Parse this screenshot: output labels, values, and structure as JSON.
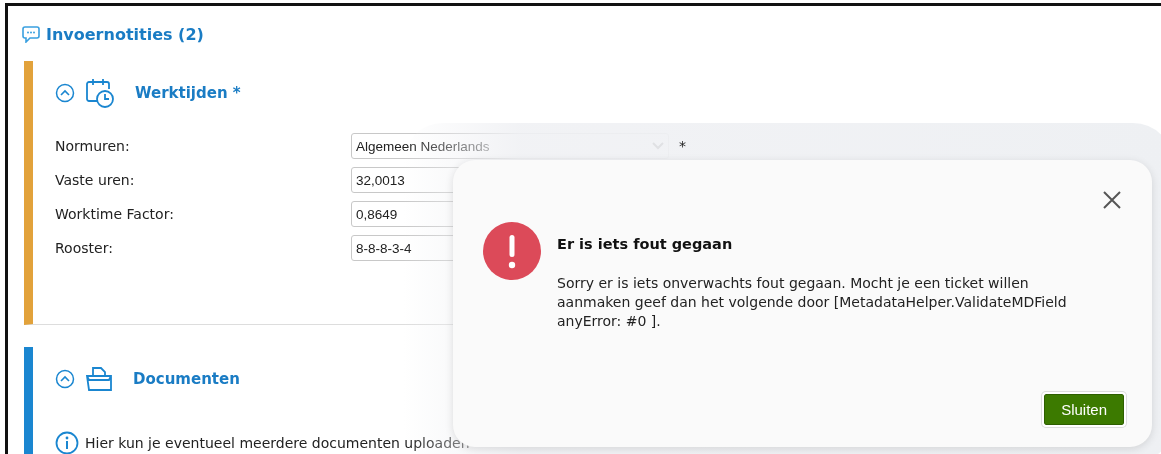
{
  "header": {
    "title": "Invoernotities (2)"
  },
  "sections": [
    {
      "title": "Werktijden *",
      "kind": "worktime",
      "color": "#e2a23b",
      "expanded": true,
      "fields": [
        {
          "label": "Normuren:",
          "kind": "select",
          "value": "Algemeen Nederlands",
          "required_mark": "*"
        },
        {
          "label": "Vaste uren:",
          "kind": "input",
          "value": "32,0013"
        },
        {
          "label": "Worktime Factor:",
          "kind": "input",
          "value": "0,8649"
        },
        {
          "label": "Rooster:",
          "kind": "input",
          "value": "8-8-8-3-4"
        }
      ]
    },
    {
      "title": "Documenten",
      "kind": "documents",
      "color": "#1a86d0",
      "expanded": true,
      "info": "Hier kun je eventueel meerdere documenten uploaden"
    }
  ],
  "dialog": {
    "title": "Er is iets fout gegaan",
    "message": "Sorry er is iets onverwachts fout gegaan. Mocht je een ticket willen aanmaken geef dan het volgende door [MetadataHelper.ValidateMDField anyError: #0 ].",
    "button": "Sluiten"
  }
}
